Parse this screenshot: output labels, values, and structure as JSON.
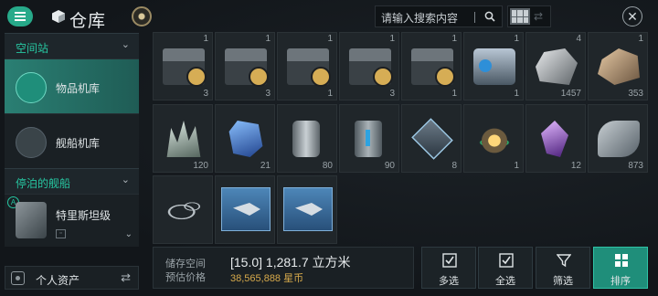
{
  "header": {
    "title": "仓库",
    "search_placeholder": "请输入搜索内容"
  },
  "sidebar": {
    "section1": "空间站",
    "items": [
      {
        "label": "物品机库"
      },
      {
        "label": "舰船机库"
      }
    ],
    "section2": "停泊的舰船",
    "ship": {
      "name": "特里斯坦级"
    },
    "assets_label": "个人资产"
  },
  "inventory": {
    "rows": [
      [
        {
          "top": "1",
          "bottom": "3",
          "icon": "crate-icon"
        },
        {
          "top": "1",
          "bottom": "3",
          "icon": "crate-icon"
        },
        {
          "top": "1",
          "bottom": "1",
          "icon": "crate-icon"
        },
        {
          "top": "1",
          "bottom": "3",
          "icon": "crate-icon"
        },
        {
          "top": "1",
          "bottom": "1",
          "icon": "crate-icon"
        },
        {
          "top": "1",
          "bottom": "1",
          "icon": "cargo-pod-icon"
        },
        {
          "top": "4",
          "bottom": "1457",
          "icon": "ore-icon"
        },
        {
          "top": "1",
          "bottom": "353",
          "icon": "ore-icon"
        }
      ],
      [
        {
          "top": "",
          "bottom": "120",
          "icon": "crystal-icon"
        },
        {
          "top": "",
          "bottom": "21",
          "icon": "blue-gem-icon"
        },
        {
          "top": "",
          "bottom": "80",
          "icon": "canister-icon"
        },
        {
          "top": "",
          "bottom": "90",
          "icon": "canister-icon"
        },
        {
          "top": "",
          "bottom": "8",
          "icon": "chip-icon"
        },
        {
          "top": "",
          "bottom": "1",
          "icon": "relic-icon"
        },
        {
          "top": "",
          "bottom": "12",
          "icon": "purple-crystal-icon"
        },
        {
          "top": "",
          "bottom": "873",
          "icon": "rolled-plates-icon"
        }
      ],
      [
        {
          "top": "",
          "bottom": "",
          "icon": "cable-icon"
        },
        {
          "top": "",
          "bottom": "",
          "icon": "blueprint-icon"
        },
        {
          "top": "",
          "bottom": "",
          "icon": "blueprint-icon"
        }
      ]
    ]
  },
  "footer": {
    "storage_label": "储存空间",
    "storage_value": "[15.0] 1,281.7 立方米",
    "price_label": "预估价格",
    "price_value": "38,565,888 星币",
    "buttons": [
      {
        "label": "多选"
      },
      {
        "label": "全选"
      },
      {
        "label": "筛选"
      },
      {
        "label": "排序"
      }
    ]
  }
}
